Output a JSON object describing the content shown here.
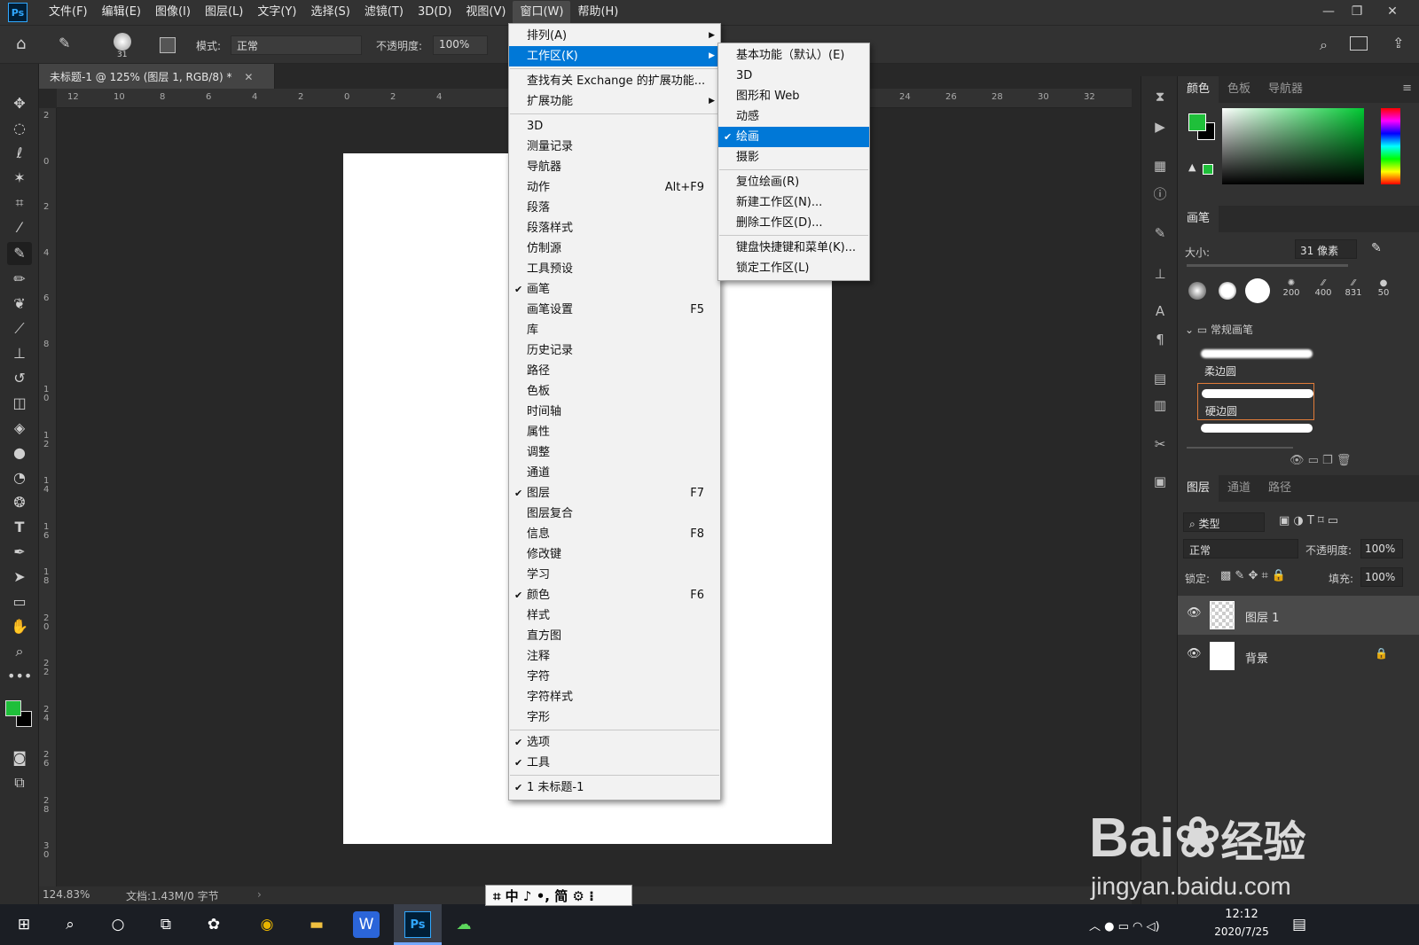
{
  "app": {
    "logo": "Ps"
  },
  "menubar": {
    "items": [
      "文件(F)",
      "编辑(E)",
      "图像(I)",
      "图层(L)",
      "文字(Y)",
      "选择(S)",
      "滤镜(T)",
      "3D(D)",
      "视图(V)",
      "窗口(W)",
      "帮助(H)"
    ],
    "active": "窗口(W)"
  },
  "window_controls": {
    "minimize": "—",
    "restore": "❐",
    "close": "✕"
  },
  "options_bar": {
    "brush_size": "31",
    "mode_label": "模式:",
    "mode_value": "正常",
    "opacity_label": "不透明度:",
    "opacity_value": "100%"
  },
  "document": {
    "tab_title": "未标题-1 @ 125% (图层 1, RGB/8) *",
    "zoom": "124.83%",
    "doc_info": "文档:1.43M/0 字节"
  },
  "ruler": {
    "top": [
      "12",
      "10",
      "8",
      "6",
      "4",
      "2",
      "0",
      "2",
      "4",
      "24",
      "26",
      "28",
      "30",
      "32"
    ],
    "left": [
      "2",
      "0",
      "2",
      "4",
      "6",
      "8",
      "1 0",
      "1 2",
      "1 4",
      "1 6",
      "1 8",
      "2 0",
      "2 2",
      "2 4",
      "2 6",
      "2 8",
      "3 0"
    ]
  },
  "window_menu": {
    "items": [
      {
        "label": "排列(A)",
        "submenu": true
      },
      {
        "label": "工作区(K)",
        "submenu": true,
        "selected": true
      },
      {
        "sep": true
      },
      {
        "label": "查找有关 Exchange 的扩展功能..."
      },
      {
        "label": "扩展功能",
        "submenu": true
      },
      {
        "sep": true
      },
      {
        "label": "3D"
      },
      {
        "label": "测量记录"
      },
      {
        "label": "导航器"
      },
      {
        "label": "动作",
        "shortcut": "Alt+F9"
      },
      {
        "label": "段落"
      },
      {
        "label": "段落样式"
      },
      {
        "label": "仿制源"
      },
      {
        "label": "工具预设"
      },
      {
        "label": "画笔",
        "checked": true
      },
      {
        "label": "画笔设置",
        "shortcut": "F5"
      },
      {
        "label": "库"
      },
      {
        "label": "历史记录"
      },
      {
        "label": "路径"
      },
      {
        "label": "色板"
      },
      {
        "label": "时间轴"
      },
      {
        "label": "属性"
      },
      {
        "label": "调整"
      },
      {
        "label": "通道"
      },
      {
        "label": "图层",
        "checked": true,
        "shortcut": "F7"
      },
      {
        "label": "图层复合"
      },
      {
        "label": "信息",
        "shortcut": "F8"
      },
      {
        "label": "修改键"
      },
      {
        "label": "学习"
      },
      {
        "label": "颜色",
        "checked": true,
        "shortcut": "F6"
      },
      {
        "label": "样式"
      },
      {
        "label": "直方图"
      },
      {
        "label": "注释"
      },
      {
        "label": "字符"
      },
      {
        "label": "字符样式"
      },
      {
        "label": "字形"
      },
      {
        "sep": true
      },
      {
        "label": "选项",
        "checked": true
      },
      {
        "label": "工具",
        "checked": true
      },
      {
        "sep": true
      },
      {
        "label": "1 未标题-1",
        "checked": true
      }
    ]
  },
  "workspace_menu": {
    "items": [
      {
        "label": "基本功能（默认）(E)"
      },
      {
        "label": "3D"
      },
      {
        "label": "图形和 Web"
      },
      {
        "label": "动感"
      },
      {
        "label": "绘画",
        "checked": true,
        "selected": true
      },
      {
        "label": "摄影"
      },
      {
        "sep": true
      },
      {
        "label": "复位绘画(R)"
      },
      {
        "label": "新建工作区(N)..."
      },
      {
        "label": "删除工作区(D)..."
      },
      {
        "sep": true
      },
      {
        "label": "键盘快捷键和菜单(K)..."
      },
      {
        "label": "锁定工作区(L)"
      }
    ]
  },
  "color_panel": {
    "tabs": [
      "颜色",
      "色板",
      "导航器"
    ],
    "foreground": "#1fbf3a",
    "background": "#000000"
  },
  "brush_panel": {
    "title": "画笔",
    "size_label": "大小:",
    "size_value": "31 像素",
    "presets": [
      "200",
      "400",
      "831",
      "50"
    ],
    "group": "常规画笔",
    "brushes": [
      "柔边圆",
      "硬边圆"
    ]
  },
  "layers_panel": {
    "tabs": [
      "图层",
      "通道",
      "路径"
    ],
    "filter": "类型",
    "blend_mode": "正常",
    "opacity_label": "不透明度:",
    "opacity_value": "100%",
    "lock_label": "锁定:",
    "fill_label": "填充:",
    "fill_value": "100%",
    "layers": [
      {
        "name": "图层 1",
        "selected": true
      },
      {
        "name": "背景",
        "locked": true
      }
    ]
  },
  "ime_bar": {
    "text": "中 ♪ •, 简"
  },
  "watermark": {
    "brand": "Bai",
    "brand2": "经验",
    "url": "jingyan.baidu.com"
  },
  "taskbar": {
    "time": "12:12",
    "date": "2020/7/25"
  },
  "colors": {
    "accent": "#0078d7",
    "ps_blue": "#31a8ff",
    "selected_brush": "#e07b39"
  }
}
